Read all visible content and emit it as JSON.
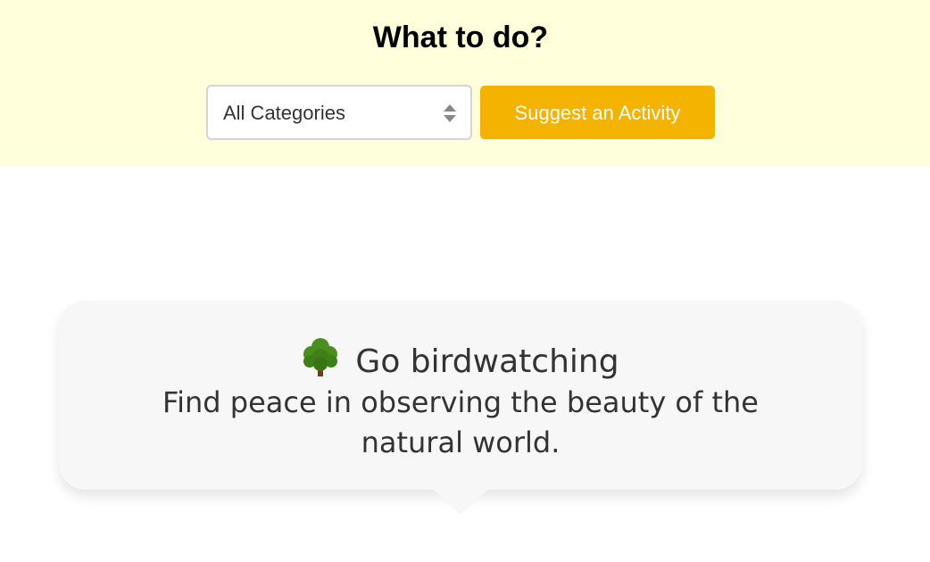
{
  "header": {
    "title": "What to do?",
    "category_select": {
      "selected": "All Categories"
    },
    "suggest_button_label": "Suggest an Activity"
  },
  "activity": {
    "icon": "tree-icon",
    "title": "Go birdwatching",
    "description": "Find peace in observing the beauty of the natural world."
  },
  "colors": {
    "header_bg": "#ffffdc",
    "button_bg": "#f3b300",
    "card_bg": "#f7f7f7"
  }
}
